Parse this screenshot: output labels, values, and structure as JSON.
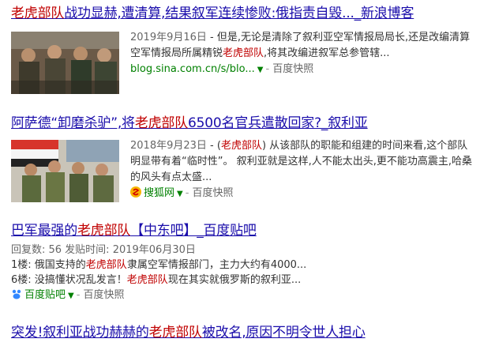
{
  "results": [
    {
      "title_pre": "",
      "title_em": "老虎部队",
      "title_post": "战功显赫,遭清算,结果叙军连续惨败:俄指责自毁..._新浪博客",
      "date": "2019年9月16日",
      "snippet_a": " - 但是,无论是清除了叙利亚空军情报局局长,还是改编清算空军情报局所属精锐",
      "snippet_em": "老虎部队",
      "snippet_b": ",将其改编进叙军总参管辖...",
      "url": "blog.sina.com.cn/s/blo...",
      "cache": "百度快照"
    },
    {
      "title_pre": "阿萨德“卸磨杀驴”,将",
      "title_em": "老虎部队",
      "title_post": "6500名官兵遣散回家?_叙利亚",
      "date": "2018年9月23日",
      "snippet_a": " - (",
      "snippet_em": "老虎部队",
      "snippet_b": ") 从该部队的职能和组建的时间来看,这个部队明显带有着“临时性”。 叙利亚就是这样,人不能太出头,更不能功高震主,哈桑的风头有点太盛...",
      "source": "搜狐网",
      "cache": "百度快照"
    },
    {
      "title_pre": "巴军最强的",
      "title_em": "老虎部队",
      "title_post": "【中东吧】_百度贴吧",
      "meta": "回复数: 56 发贴时间: 2019年06月30日",
      "line1_a": "1楼: 俄国支持的",
      "line1_em": "老虎部队",
      "line1_b": "隶属空军情报部门，主力大约有4000...",
      "line2_a": "6楼: 没搞懂状况乱发言！",
      "line2_em": "老虎部队",
      "line2_b": "现在其实就俄罗斯的叙利亚...",
      "source": "百度贴吧",
      "cache": "百度快照"
    },
    {
      "title_pre": "突发!叙利亚战功赫赫的",
      "title_em": "老虎部队",
      "title_post": "被改名,原因不明令世人担心"
    }
  ],
  "colors": {
    "link": "#1a0dab",
    "highlight": "#c00000",
    "url": "#008000",
    "muted": "#666666"
  },
  "icons": [
    "sohu-icon",
    "tieba-icon",
    "dropdown-arrow-icon"
  ]
}
